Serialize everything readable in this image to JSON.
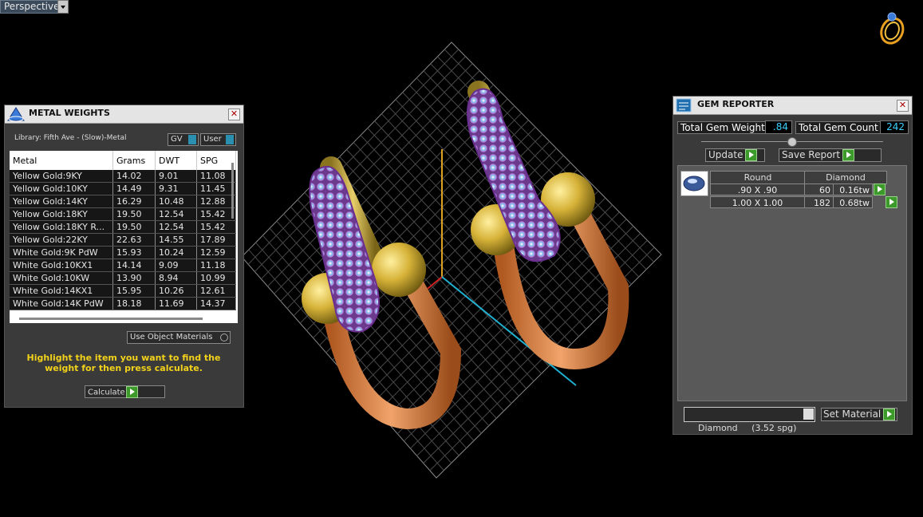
{
  "viewport": {
    "label": "Perspective"
  },
  "metal_weights": {
    "title": "METAL WEIGHTS",
    "library": "Library: Fifth Ave - (Slow)-Metal",
    "gv_label": "GV",
    "user_label": "User",
    "columns": [
      "Metal",
      "Grams",
      "DWT",
      "SPG"
    ],
    "rows": [
      {
        "metal": "Yellow Gold:9KY",
        "grams": "14.02",
        "dwt": "9.01",
        "spg": "11.08"
      },
      {
        "metal": "Yellow Gold:10KY",
        "grams": "14.49",
        "dwt": "9.31",
        "spg": "11.45"
      },
      {
        "metal": "Yellow Gold:14KY",
        "grams": "16.29",
        "dwt": "10.48",
        "spg": "12.88"
      },
      {
        "metal": "Yellow Gold:18KY",
        "grams": "19.50",
        "dwt": "12.54",
        "spg": "15.42"
      },
      {
        "metal": "Yellow Gold:18KY R...",
        "grams": "19.50",
        "dwt": "12.54",
        "spg": "15.42"
      },
      {
        "metal": "Yellow Gold:22KY",
        "grams": "22.63",
        "dwt": "14.55",
        "spg": "17.89"
      },
      {
        "metal": "White Gold:9K PdW",
        "grams": "15.93",
        "dwt": "10.24",
        "spg": "12.59"
      },
      {
        "metal": "White Gold:10KX1",
        "grams": "14.14",
        "dwt": "9.09",
        "spg": "11.18"
      },
      {
        "metal": "White Gold:10KW",
        "grams": "13.90",
        "dwt": "8.94",
        "spg": "10.99"
      },
      {
        "metal": "White Gold:14KX1",
        "grams": "15.95",
        "dwt": "10.26",
        "spg": "12.61"
      },
      {
        "metal": "White Gold:14K PdW",
        "grams": "18.18",
        "dwt": "11.69",
        "spg": "14.37"
      }
    ],
    "use_object_materials": "Use Object Materials",
    "hint": "Highlight the item you want to find the weight for then press calculate.",
    "calculate_label": "Calculate"
  },
  "gem_reporter": {
    "title": "GEM REPORTER",
    "total_weight_label": "Total Gem Weight",
    "total_weight_value": ".84",
    "total_count_label": "Total Gem Count",
    "total_count_value": "242",
    "update_label": "Update",
    "save_report_label": "Save Report",
    "shape": "Round",
    "material": "Diamond",
    "gems": [
      {
        "size": ".90 X .90",
        "count": "60",
        "weight": "0.16tw"
      },
      {
        "size": "1.00 X 1.00",
        "count": "182",
        "weight": "0.68tw"
      }
    ],
    "material_select": "Diamond     (3.52 spg)",
    "set_material_label": "Set Material"
  },
  "colors": {
    "accent_green": "#3c9a2a",
    "value_cyan": "#3cd0ff",
    "hint_yellow": "#f2d21a"
  }
}
